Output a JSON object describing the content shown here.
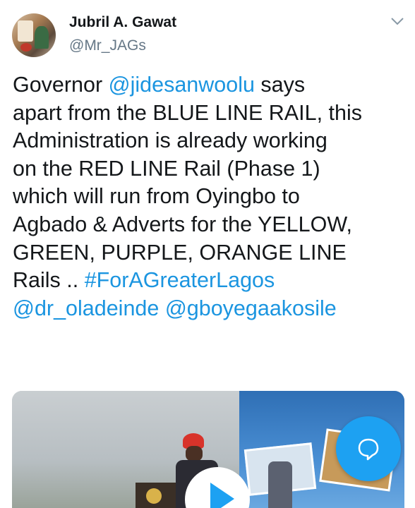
{
  "author": {
    "name": "Jubril A. Gawat",
    "handle": "@Mr_JAGs",
    "avatar_icon": "profile-photo"
  },
  "menu": {
    "icon": "chevron-down-icon"
  },
  "tweet": {
    "lines": [
      [
        {
          "text": "Governor ",
          "link": false
        },
        {
          "text": "@jidesanwoolu",
          "link": true
        },
        {
          "text": " says",
          "link": false
        }
      ],
      [
        {
          "text": "apart from the BLUE LINE RAIL, this",
          "link": false
        }
      ],
      [
        {
          "text": "Administration is already working",
          "link": false
        }
      ],
      [
        {
          "text": "on the RED LINE Rail (Phase 1)",
          "link": false
        }
      ],
      [
        {
          "text": "which will run from Oyingbo to",
          "link": false
        }
      ],
      [
        {
          "text": "Agbado & Adverts for the YELLOW,",
          "link": false
        }
      ],
      [
        {
          "text": "GREEN, PURPLE, ORANGE LINE",
          "link": false
        }
      ],
      [
        {
          "text": "Rails .. ",
          "link": false
        },
        {
          "text": "#ForAGreaterLagos",
          "link": true
        }
      ],
      [
        {
          "text": "@dr_oladeinde",
          "link": true
        },
        {
          "text": " ",
          "link": false
        },
        {
          "text": "@gboyegaakosile",
          "link": true
        }
      ]
    ]
  },
  "media": {
    "type": "video",
    "play_icon": "play-icon"
  },
  "compose": {
    "icon": "compose-reply-icon"
  },
  "colors": {
    "link": "#1b95e0",
    "accent": "#1da1f2",
    "text": "#14171a",
    "secondary": "#657786"
  }
}
